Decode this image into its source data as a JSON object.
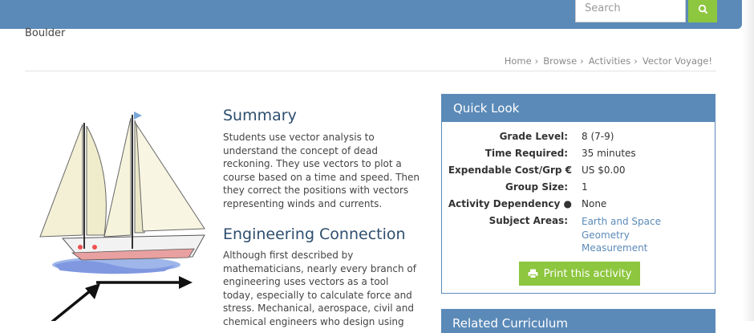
{
  "header": {
    "search_placeholder": "Search",
    "colors": {
      "bar": "#5b8ab8",
      "search_button": "#8dc63f"
    }
  },
  "org": "Boulder",
  "breadcrumb": [
    "Home",
    "Browse",
    "Activities",
    "Vector Voyage!"
  ],
  "summary": {
    "title": "Summary",
    "lines": [
      "Students use vector analysis to",
      "understand the concept of dead",
      "reckoning. They use vectors to plot a",
      "course based on a time and speed. Then",
      "they correct the positions with vectors",
      "representing winds and currents."
    ]
  },
  "engineering": {
    "title": "Engineering Connection",
    "lines": [
      "Although first described by",
      "mathematicians, nearly every branch of",
      "engineering uses vectors as a tool",
      "today, especially to calculate force and",
      "stress. Mechanical, aerospace, civil and",
      "chemical engineers who design using"
    ]
  },
  "quick_look": {
    "title": "Quick Look",
    "rows": [
      {
        "label": "Grade Level:",
        "value": "8 (7-9)"
      },
      {
        "label": "Time Required:",
        "value": "35 minutes"
      },
      {
        "label": "Expendable Cost/Grp",
        "value": "US $0.00"
      },
      {
        "label": "Group Size:",
        "value": "1"
      },
      {
        "label": "Activity Dependency",
        "value": "None"
      },
      {
        "label": "Subject Areas:",
        "value": ""
      }
    ],
    "subject_areas": [
      "Earth and Space",
      "Geometry",
      "Measurement"
    ],
    "print_label": "Print this activity"
  },
  "related": {
    "title": "Related Curriculum"
  }
}
